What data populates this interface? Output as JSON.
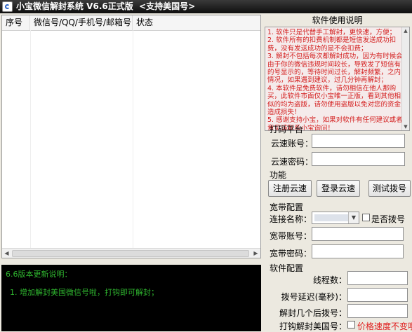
{
  "window": {
    "title": "小宝微信解封系统 V6.6正式版  <支持美国号>",
    "icon": "app-icon"
  },
  "list": {
    "columns": [
      "序号",
      "微信号/QQ/手机号/邮箱号",
      "状态"
    ],
    "rows": []
  },
  "console": {
    "lines": [
      "6.6版本更新说明：",
      "1. 增加解封美国微信号啦，打钩即可解封；"
    ]
  },
  "help": {
    "title": "软件使用说明",
    "paragraphs": [
      "1. 软件只是代替手工解封，更快速，方便；",
      "2. 软件所有的扣费机制都是短信发送成功扣费，没有发送成功的是不会扣费；",
      "3. 解封不包括每次都解封成功，因为有时候会由于你的微信违规时间较长，导致发了短信有的号显示的，等待时间过长，解封频繁，之内情况，如果遇到建议，过几分钟再解封；",
      "4. 本软件是免费软件，请勿相信在他人那购买，此软件市面仅小宝唯一正版，看到其他相似的均为盗版，请勿使用盗版以免对您的资金造成损失！",
      "5. 感谢支持小宝，如果对软件有任何建议或者意见请联系小宝询问！"
    ]
  },
  "platform": {
    "title": "打码平台",
    "account_label": "云速账号：",
    "account_value": "",
    "password_label": "云速密码：",
    "password_value": ""
  },
  "functions": {
    "title": "功能",
    "buttons": [
      "注册云速",
      "登录云速",
      "测试拨号"
    ]
  },
  "broadband": {
    "title": "宽带配置",
    "connection_label": "连接名称：",
    "connection_value": "",
    "dialup_label": "是否拨号",
    "dialup_checked": false,
    "account_label": "宽带账号：",
    "account_value": "",
    "password_label": "宽带密码：",
    "password_value": ""
  },
  "settings": {
    "title": "软件配置",
    "threads_label": "线程数：",
    "threads_value": "",
    "delay_label": "拨号延迟(毫秒)：",
    "delay_value": "",
    "redial_label": "解封几个后拨号：",
    "redial_value": "",
    "us_label": "打钩解封美国号：",
    "us_checked": false,
    "us_warning": "价格速度不变哦"
  },
  "colors": {
    "titlebar": "#1a1a1a",
    "help_text": "#d42020",
    "console_bg": "#000000",
    "console_text": "#2fb52f",
    "warning": "#e02020"
  }
}
